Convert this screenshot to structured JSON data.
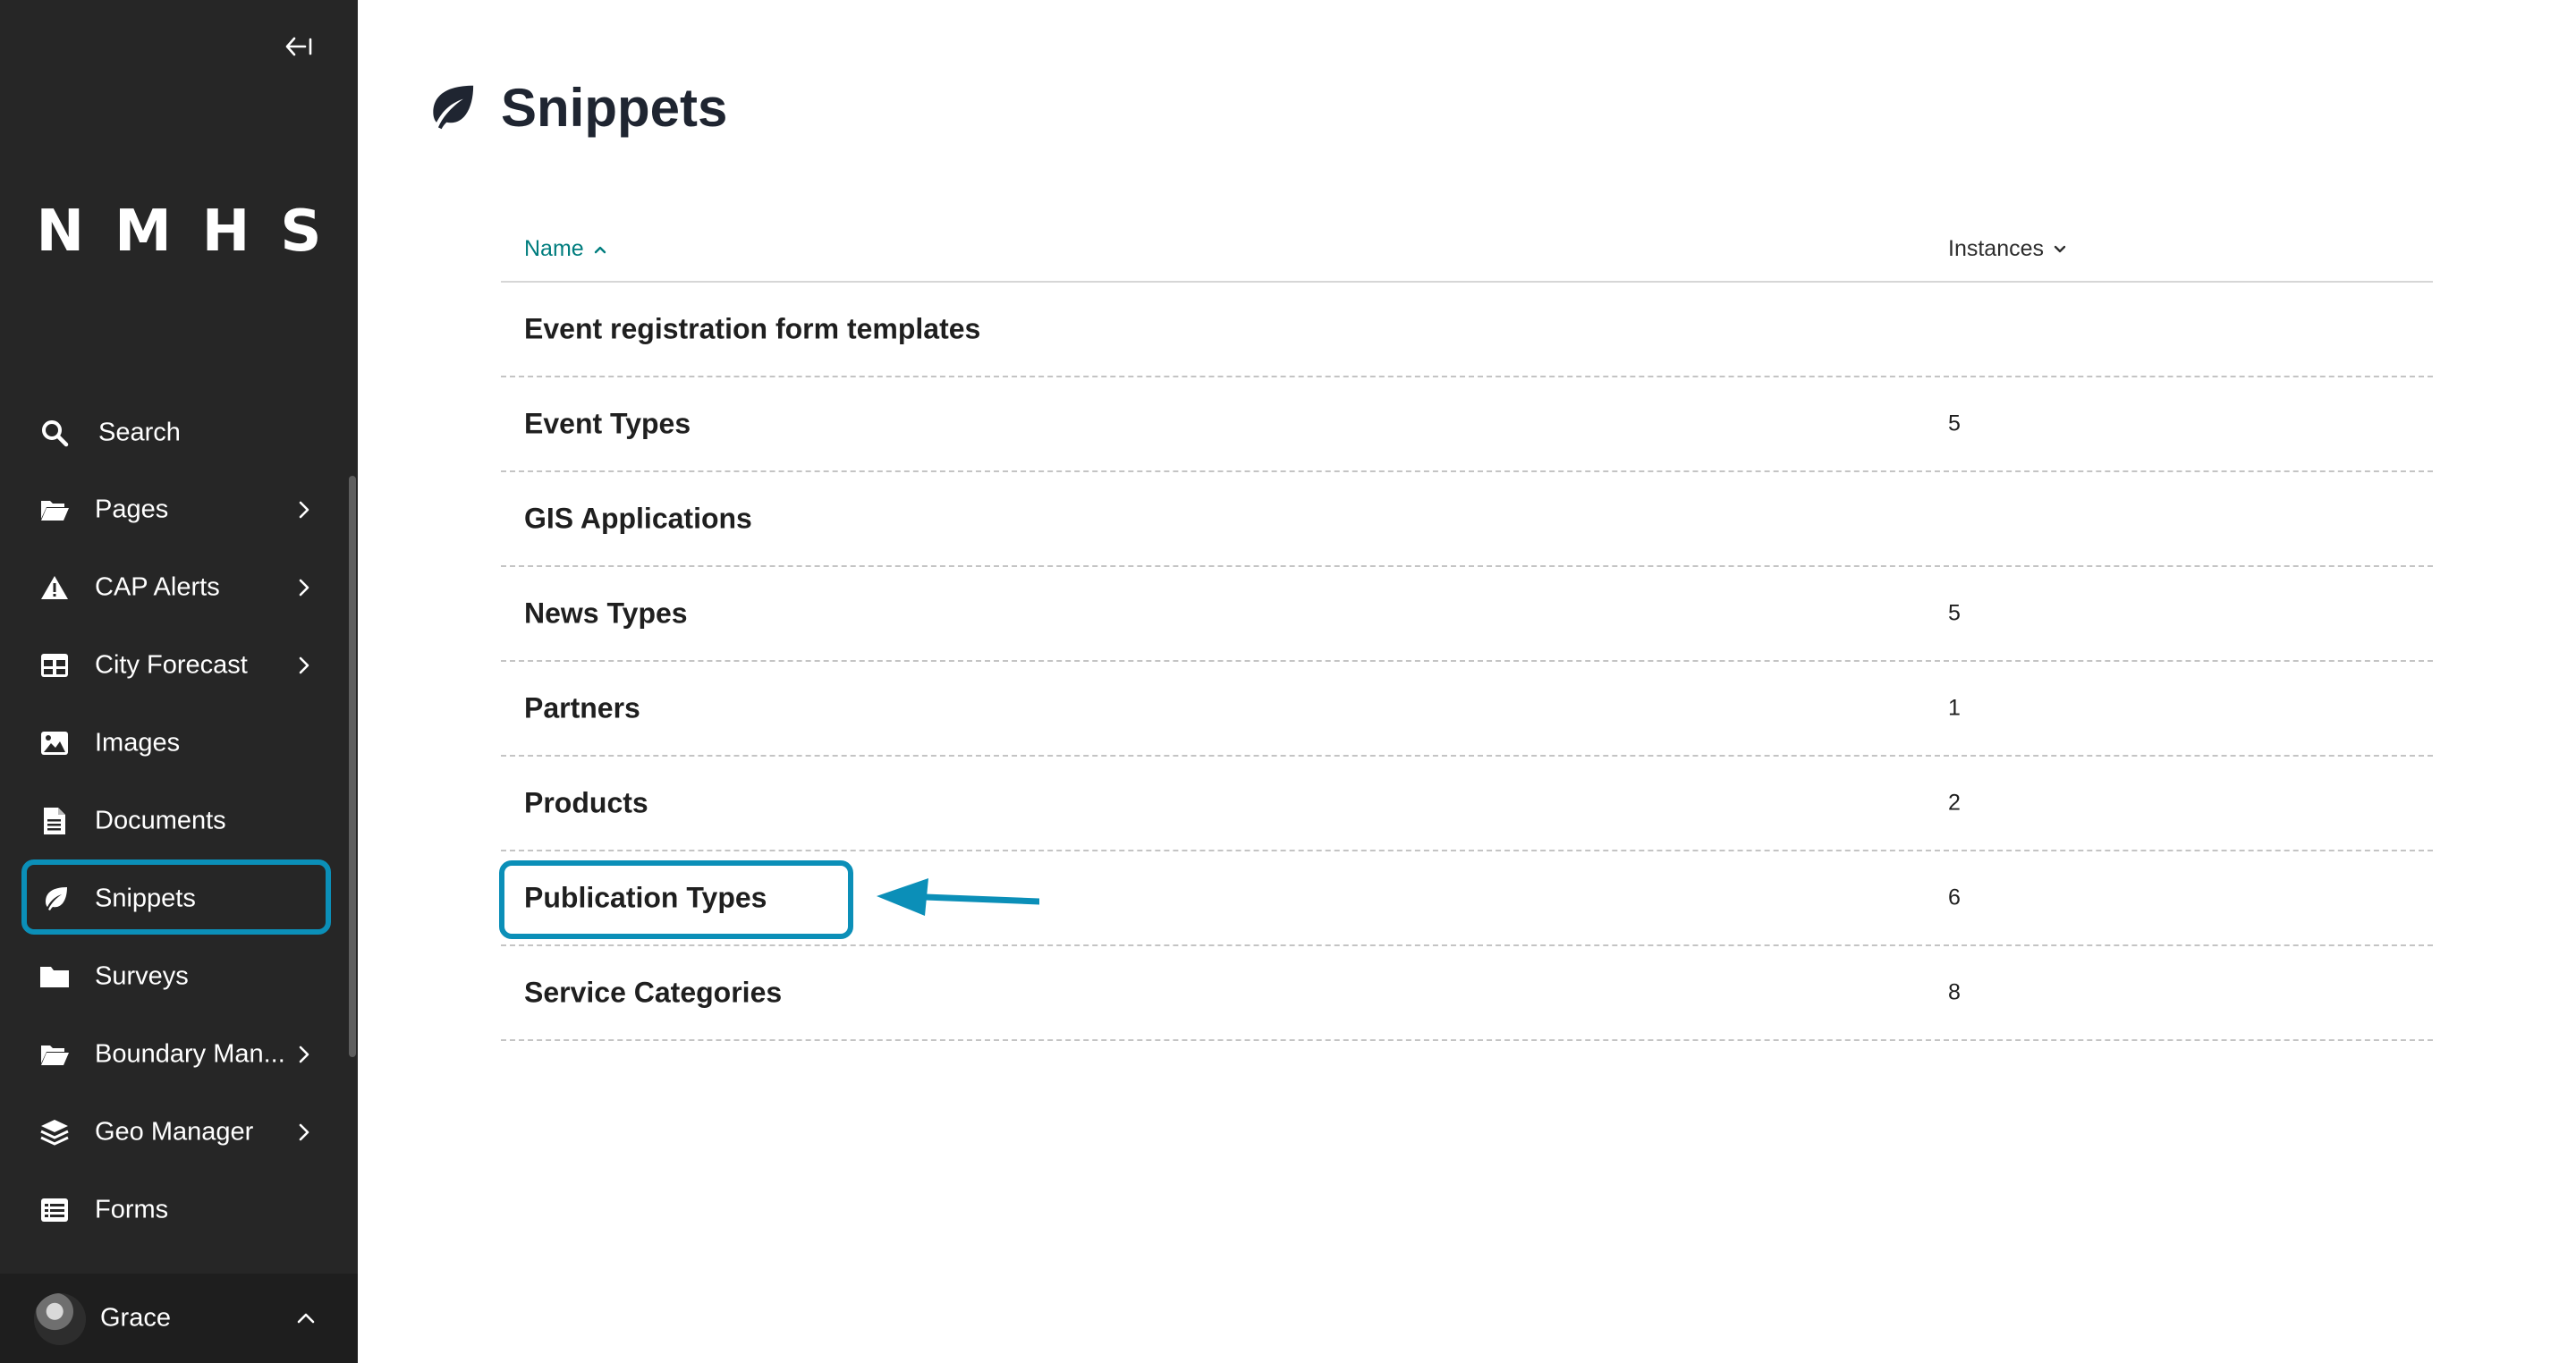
{
  "sidebar": {
    "collapse_icon": "collapse-left-icon",
    "logo": "NMHS",
    "items": [
      {
        "label": "Search",
        "icon": "search-icon",
        "has_children": false
      },
      {
        "label": "Pages",
        "icon": "folder-open-icon",
        "has_children": true
      },
      {
        "label": "CAP Alerts",
        "icon": "warning-icon",
        "has_children": true
      },
      {
        "label": "City Forecast",
        "icon": "table-icon",
        "has_children": true
      },
      {
        "label": "Images",
        "icon": "image-icon",
        "has_children": false
      },
      {
        "label": "Documents",
        "icon": "document-icon",
        "has_children": false
      },
      {
        "label": "Snippets",
        "icon": "leaf-icon",
        "has_children": false,
        "active": true
      },
      {
        "label": "Surveys",
        "icon": "folder-icon",
        "has_children": false
      },
      {
        "label": "Boundary Man...",
        "icon": "folder-open-icon",
        "has_children": true
      },
      {
        "label": "Geo Manager",
        "icon": "layers-icon",
        "has_children": true
      },
      {
        "label": "Forms",
        "icon": "list-icon",
        "has_children": false
      }
    ],
    "account": {
      "name": "Grace"
    }
  },
  "page": {
    "title": "Snippets",
    "icon": "leaf-icon"
  },
  "table": {
    "columns": {
      "name": "Name",
      "instances": "Instances"
    },
    "rows": [
      {
        "name": "Event registration form templates",
        "count": ""
      },
      {
        "name": "Event Types",
        "count": "5"
      },
      {
        "name": "GIS Applications",
        "count": ""
      },
      {
        "name": "News Types",
        "count": "5"
      },
      {
        "name": "Partners",
        "count": "1"
      },
      {
        "name": "Products",
        "count": "2"
      },
      {
        "name": "Publication Types",
        "count": "6"
      },
      {
        "name": "Service Categories",
        "count": "8"
      }
    ]
  },
  "colors": {
    "sidebar_bg": "#262626",
    "highlight": "#0b8fb8",
    "sort_link": "#007d7e"
  }
}
